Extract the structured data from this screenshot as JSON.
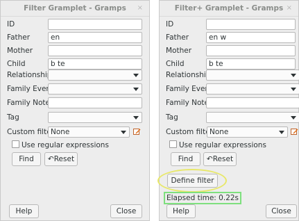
{
  "left": {
    "title": "Filter Gramplet - Gramps",
    "close_glyph": "×",
    "fields": [
      {
        "label": "ID",
        "value": ""
      },
      {
        "label": "Father",
        "value": "en"
      },
      {
        "label": "Mother",
        "value": ""
      },
      {
        "label": "Child",
        "value": "b te"
      }
    ],
    "combos": [
      {
        "label": "Relationship",
        "value": ""
      },
      {
        "label": "Family Event",
        "value": ""
      }
    ],
    "family_note": {
      "label": "Family Note",
      "value": ""
    },
    "tag": {
      "label": "Tag",
      "value": ""
    },
    "custom_filter": {
      "label": "Custom filter",
      "value": "None"
    },
    "use_regex": "Use regular expressions",
    "find": "Find",
    "reset": "Reset",
    "help": "Help",
    "close": "Close"
  },
  "right": {
    "title": "Filter+ Gramplet - Gramps",
    "close_glyph": "×",
    "fields": [
      {
        "label": "ID",
        "value": ""
      },
      {
        "label": "Father",
        "value": "en w"
      },
      {
        "label": "Mother",
        "value": ""
      },
      {
        "label": "Child",
        "value": "b te"
      }
    ],
    "combos": [
      {
        "label": "Relationship",
        "value": ""
      },
      {
        "label": "Family Event",
        "value": ""
      }
    ],
    "family_note": {
      "label": "Family Note",
      "value": ""
    },
    "tag": {
      "label": "Tag",
      "value": ""
    },
    "custom_filter": {
      "label": "Custom filter",
      "value": "None"
    },
    "use_regex": "Use regular expressions",
    "find": "Find",
    "reset": "Reset",
    "define_filter": "Define filter",
    "elapsed": "Elapsed time: 0.22s",
    "help": "Help",
    "close": "Close"
  },
  "colors": {
    "highlight_ellipse": "#e8e86a",
    "elapsed_box": "#7ee07e",
    "edit_icon": "#e0701a"
  }
}
